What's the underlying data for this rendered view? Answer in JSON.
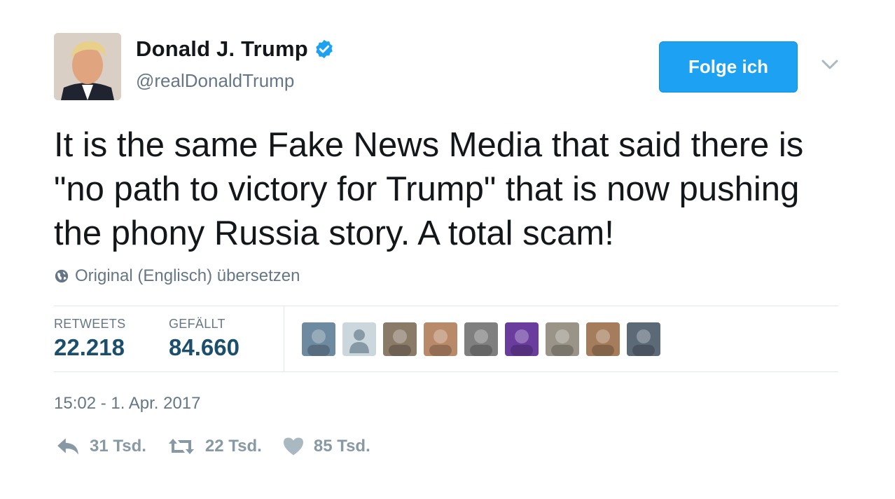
{
  "user": {
    "name": "Donald J. Trump",
    "handle": "@realDonaldTrump",
    "verified": true
  },
  "follow_button": {
    "label": "Folge ich"
  },
  "tweet": {
    "text": "It is the same Fake News Media that said there is \"no path to victory for Trump\" that is now pushing the phony Russia story. A total scam!",
    "translate_link": "Original (Englisch) übersetzen",
    "timestamp": "15:02 - 1. Apr. 2017"
  },
  "stats": {
    "retweets": {
      "label": "RETWEETS",
      "value": "22.218"
    },
    "likes": {
      "label": "GEFÄLLT",
      "value": "84.660"
    }
  },
  "liker_avatars": [
    {
      "name": "liker-avatar-1",
      "color": "#6e8aa0"
    },
    {
      "name": "liker-avatar-2",
      "color": "#ccd6dd"
    },
    {
      "name": "liker-avatar-3",
      "color": "#8a7a68"
    },
    {
      "name": "liker-avatar-4",
      "color": "#b98a6a"
    },
    {
      "name": "liker-avatar-5",
      "color": "#7f7f7f"
    },
    {
      "name": "liker-avatar-6",
      "color": "#6a3c9e"
    },
    {
      "name": "liker-avatar-7",
      "color": "#9a9488"
    },
    {
      "name": "liker-avatar-8",
      "color": "#a57d5c"
    },
    {
      "name": "liker-avatar-9",
      "color": "#5c6a78"
    }
  ],
  "actions": {
    "reply": {
      "icon": "reply-icon",
      "count": "31 Tsd."
    },
    "retweet": {
      "icon": "retweet-icon",
      "count": "22 Tsd."
    },
    "like": {
      "icon": "heart-icon",
      "count": "85 Tsd."
    }
  },
  "colors": {
    "accent": "#1da1f2",
    "verified": "#1da1f2",
    "muted": "#657786",
    "stat_value": "#1c4f6b"
  }
}
